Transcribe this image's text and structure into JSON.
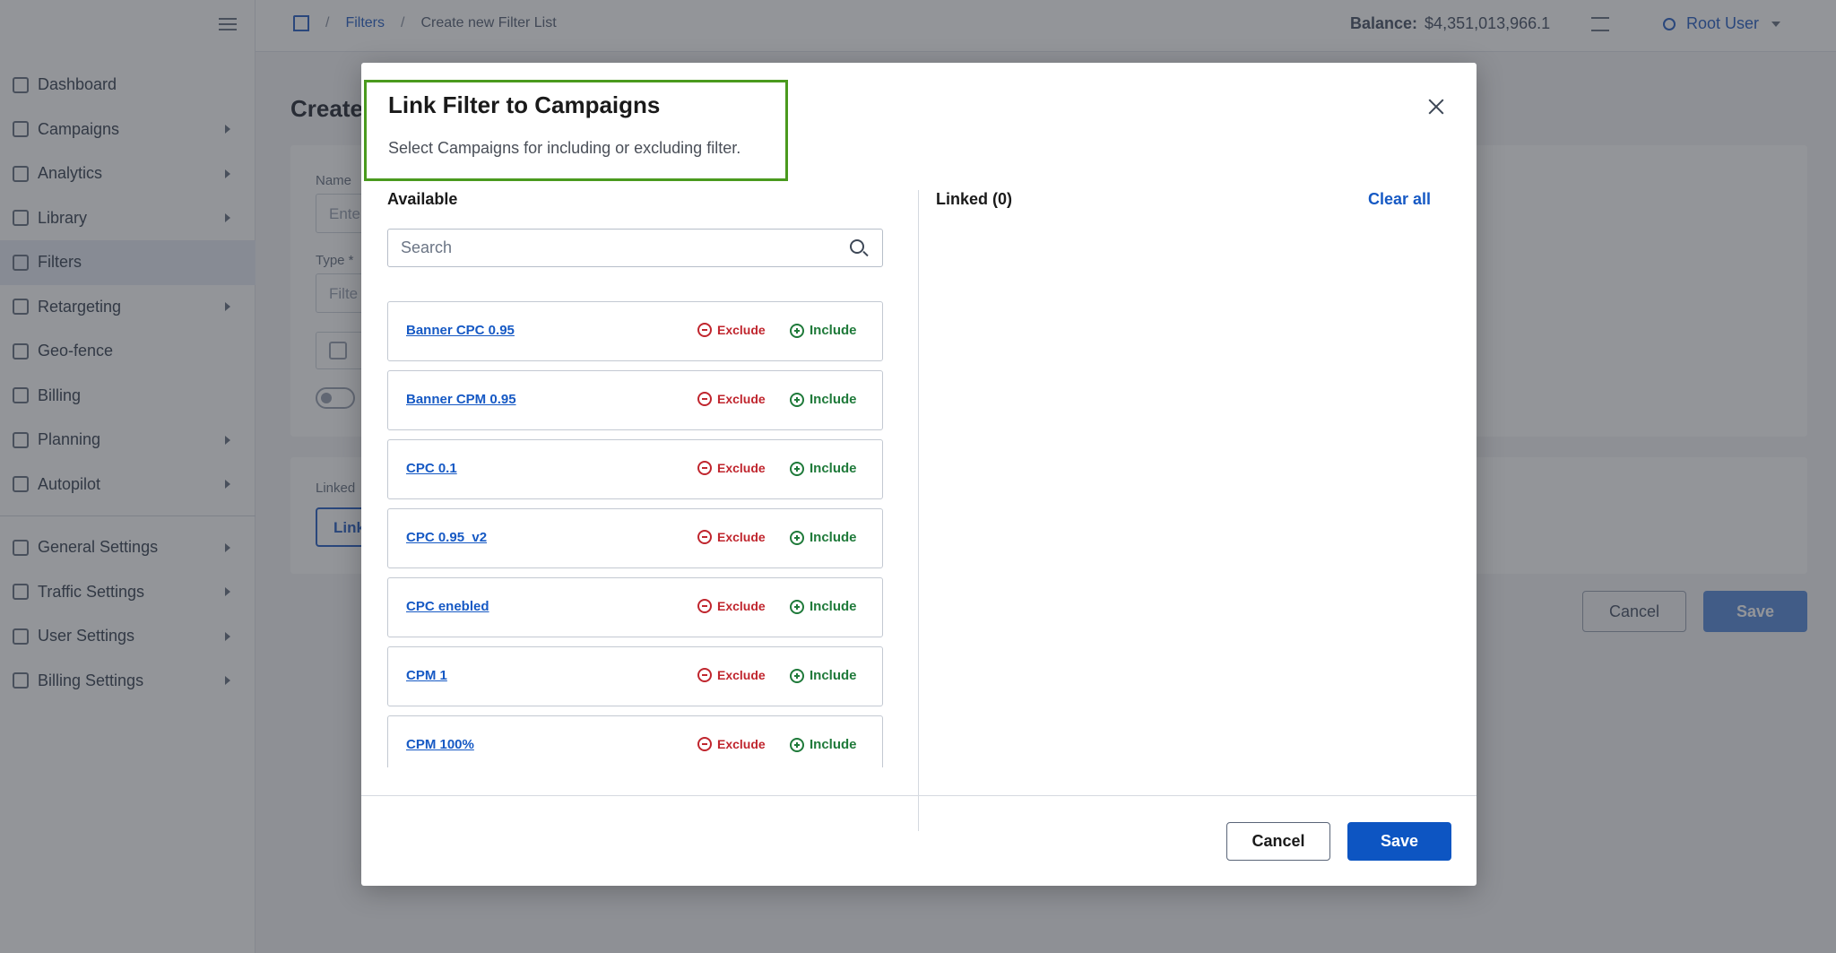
{
  "sidebar": {
    "items": [
      {
        "label": "Dashboard",
        "icon": "dashboard-icon",
        "has_submenu": false
      },
      {
        "label": "Campaigns",
        "icon": "megaphone-icon",
        "has_submenu": true
      },
      {
        "label": "Analytics",
        "icon": "chart-icon",
        "has_submenu": true
      },
      {
        "label": "Library",
        "icon": "image-icon",
        "has_submenu": true
      },
      {
        "label": "Filters",
        "icon": "filter-icon",
        "has_submenu": false,
        "active": true
      },
      {
        "label": "Retargeting",
        "icon": "refresh-icon",
        "has_submenu": true
      },
      {
        "label": "Geo-fence",
        "icon": "pin-icon",
        "has_submenu": false
      },
      {
        "label": "Billing",
        "icon": "card-icon",
        "has_submenu": false
      },
      {
        "label": "Planning",
        "icon": "calendar-icon",
        "has_submenu": true
      },
      {
        "label": "Autopilot",
        "icon": "play-icon",
        "has_submenu": true
      }
    ],
    "settings": [
      {
        "label": "General Settings",
        "icon": "gear-icon"
      },
      {
        "label": "Traffic Settings",
        "icon": "traffic-icon"
      },
      {
        "label": "User Settings",
        "icon": "users-icon"
      },
      {
        "label": "Billing Settings",
        "icon": "wallet-icon"
      }
    ]
  },
  "topbar": {
    "breadcrumb": [
      "Filters",
      "Create new Filter List"
    ],
    "balance_label": "Balance:",
    "balance_value": "$4,351,013,966.1",
    "user_name": "Root User"
  },
  "background": {
    "page_title": "Create",
    "name_label": "Name",
    "name_placeholder": "Ente",
    "type_label": "Type *",
    "type_placeholder": "Filte",
    "linked_label": "Linked",
    "link_button": "Link",
    "cancel": "Cancel",
    "save": "Save"
  },
  "modal": {
    "title": "Link Filter to Campaigns",
    "subtitle": "Select Campaigns for including or excluding filter.",
    "available_title": "Available",
    "linked_title": "Linked (0)",
    "clear_all": "Clear all",
    "search_placeholder": "Search",
    "exclude_label": "Exclude",
    "include_label": "Include",
    "campaigns": [
      "Banner CPC 0.95",
      "Banner CPM 0.95",
      "CPC 0.1",
      "CPC 0.95_v2",
      "CPC enebled",
      "CPM 1",
      "CPM 100%"
    ],
    "cancel": "Cancel",
    "save": "Save"
  },
  "colors": {
    "accent": "#0d55c2",
    "exclude": "#c0262e",
    "include": "#1f7a3a",
    "highlight_border": "#4a9a1e"
  }
}
